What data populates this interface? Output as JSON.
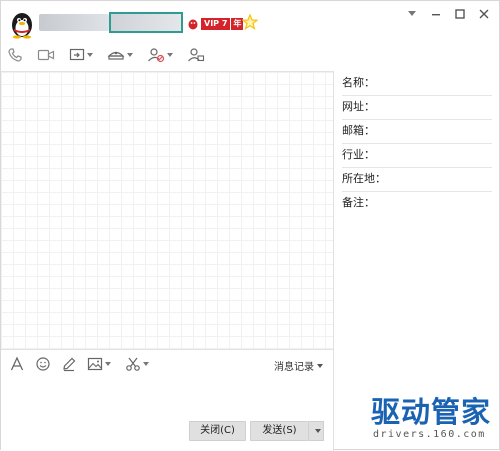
{
  "header": {
    "vip_label": "VIP 7",
    "year_label": "年"
  },
  "window_controls": [
    "chevron-down-icon",
    "minimize-icon",
    "maximize-icon",
    "close-icon"
  ],
  "toolbar": [
    "phone-icon",
    "video-icon",
    "screen-share-icon",
    "remote-assist-icon",
    "add-friend-icon",
    "group-chat-icon"
  ],
  "info_panel": {
    "fields": [
      {
        "label": "名称："
      },
      {
        "label": "网址："
      },
      {
        "label": "邮箱："
      },
      {
        "label": "行业："
      },
      {
        "label": "所在地："
      },
      {
        "label": "备注："
      }
    ]
  },
  "input_toolbar": {
    "icons": [
      "font-icon",
      "emoji-icon",
      "pen-icon",
      "image-icon",
      "scissors-icon"
    ],
    "history_label": "消息记录"
  },
  "buttons": {
    "close_label": "关闭(C)",
    "send_label": "发送(S)"
  },
  "watermark": {
    "title": "驱动管家",
    "url": "drivers.160.com"
  },
  "colors": {
    "accent_border": "#2f9c92",
    "vip_red": "#d4232a",
    "star_yellow": "#f5c518",
    "watermark_blue": "#1a63b3"
  }
}
